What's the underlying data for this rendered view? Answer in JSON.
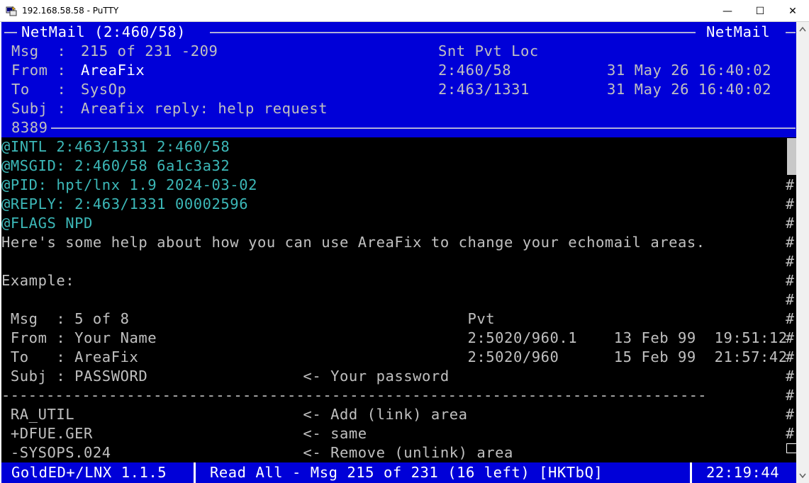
{
  "window": {
    "title": "192.168.58.58 - PuTTY",
    "minimize": "—",
    "maximize": "☐",
    "close": "✕"
  },
  "header": {
    "area_left": "NetMail (2:460/58)",
    "area_right": "NetMail",
    "msg_label": "Msg  :",
    "msg_value": "215 of 231 -209",
    "flags_header": "Snt Pvt Loc",
    "from_label": "From :",
    "from_name": "AreaFix",
    "from_addr": "2:460/58",
    "from_date": "31 May 26 16:40:02",
    "to_label": "To   :",
    "to_name": "SysOp",
    "to_addr": "2:463/1331",
    "to_date": "31 May 26 16:40:02",
    "subj_label": "Subj :",
    "subj_value": "Areafix reply: help request",
    "counter": "8389"
  },
  "body_lines": {
    "l1": "@INTL 2:463/1331 2:460/58",
    "l2": "@MSGID: 2:460/58 6a1c3a32",
    "l3": "@PID: hpt/lnx 1.9 2024-03-02",
    "l4": "@REPLY: 2:463/1331 00002596",
    "l5": "@FLAGS NPD",
    "l6": "Here's some help about how you can use AreaFix to change your echomail areas.",
    "l7": "Example:",
    "l8": " Msg  : 5 of 8                                     Pvt",
    "l9": " From : Your Name                                  2:5020/960.1    13 Feb 99  19:51:12",
    "l10": " To   : AreaFix                                    2:5020/960      15 Feb 99  21:57:42",
    "l11": " Subj : PASSWORD                 <- Your password",
    "l12": "-------------------------------------------------------------------------------",
    "l13": " RA_UTIL                         <- Add (link) area",
    "l14": " +DFUE.GER                       <- same",
    "l15": " -SYSOPS.024                     <- Remove (unlink) area"
  },
  "hash_mark": "#",
  "status": {
    "program": "GoldED+/LNX 1.1.5",
    "mode": "Read All - Msg 215 of 231 (16 left) [HKTbQ]",
    "clock": "22:19:44"
  },
  "colors": {
    "header_bg": "#0000d8",
    "kludge": "#3cb8b8",
    "text": "#c0c0c0",
    "highlight": "#ffffff"
  },
  "icons": {
    "app": "putty-icon"
  }
}
